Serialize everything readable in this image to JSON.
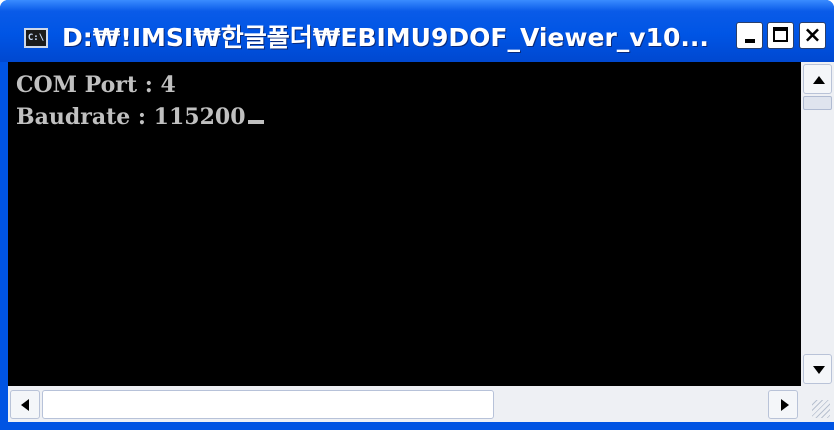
{
  "window": {
    "title": "D:₩!IMSI₩한글폴더₩EBIMU9DOF_Viewer_v10...",
    "icon_label": "C:\\",
    "buttons": {
      "minimize": "minimize-icon",
      "maximize": "maximize-icon",
      "close": "×"
    }
  },
  "console": {
    "lines": [
      "COM Port : 4",
      "Baudrate : 115200"
    ],
    "background": "#000000",
    "text_color": "#c0c0c0"
  },
  "colors": {
    "titlebar": "#0055e5",
    "frame": "#0054e3"
  }
}
